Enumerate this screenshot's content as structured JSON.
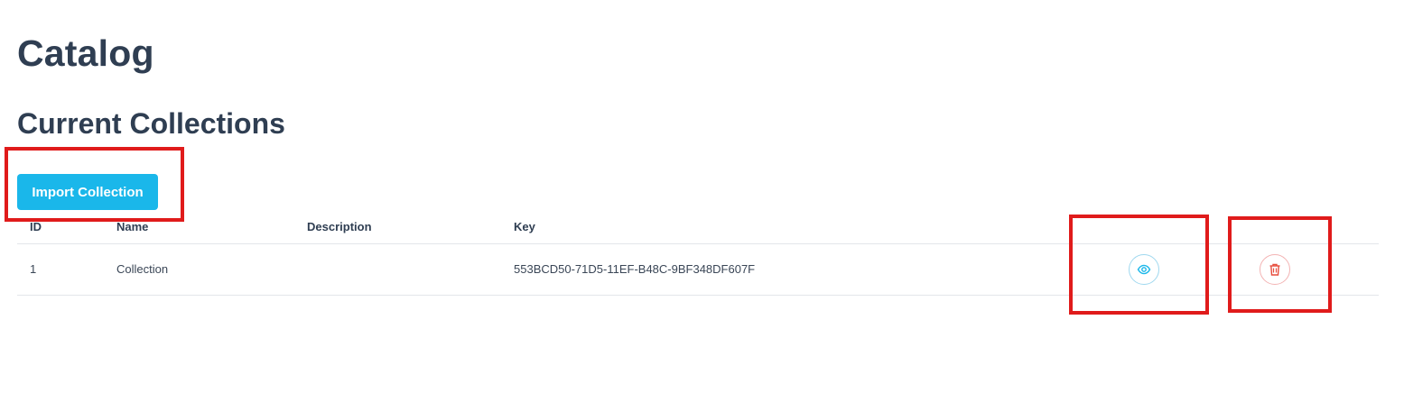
{
  "page": {
    "title": "Catalog",
    "section_title": "Current Collections"
  },
  "toolbar": {
    "import_label": "Import Collection"
  },
  "table": {
    "columns": [
      "ID",
      "Name",
      "Description",
      "Key"
    ],
    "rows": [
      {
        "id": "1",
        "name": "Collection",
        "description": "",
        "key": "553BCD50-71D5-11EF-B48C-9BF348DF607F",
        "actions": [
          "eye-icon",
          "trash-icon"
        ]
      }
    ]
  },
  "colors": {
    "primary": "#1ab7ea",
    "heading": "#2f3e52",
    "danger": "#e74c3c",
    "annotation": "#e01b1b"
  }
}
